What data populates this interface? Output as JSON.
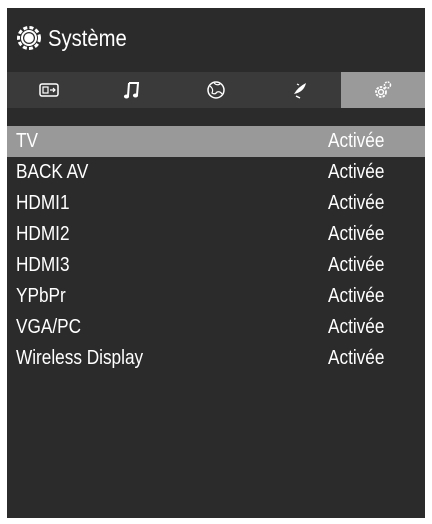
{
  "header": {
    "title": "Système",
    "icon": "gear-icon"
  },
  "tabs": [
    {
      "icon": "picture-icon",
      "active": false
    },
    {
      "icon": "music-note-icon",
      "active": false
    },
    {
      "icon": "globe-icon",
      "active": false
    },
    {
      "icon": "satellite-dish-icon",
      "active": false
    },
    {
      "icon": "settings-gears-icon",
      "active": true
    }
  ],
  "sources": [
    {
      "name": "TV",
      "status": "Activée",
      "selected": true
    },
    {
      "name": "BACK AV",
      "status": "Activée",
      "selected": false
    },
    {
      "name": "HDMI1",
      "status": "Activée",
      "selected": false
    },
    {
      "name": "HDMI2",
      "status": "Activée",
      "selected": false
    },
    {
      "name": "HDMI3",
      "status": "Activée",
      "selected": false
    },
    {
      "name": "YPbPr",
      "status": "Activée",
      "selected": false
    },
    {
      "name": "VGA/PC",
      "status": "Activée",
      "selected": false
    },
    {
      "name": "Wireless Display",
      "status": "Activée",
      "selected": false
    }
  ],
  "colors": {
    "panel_background": "#2b2b2b",
    "tab_bar": "#3a3a3a",
    "highlight": "#999999",
    "text": "#ffffff"
  }
}
